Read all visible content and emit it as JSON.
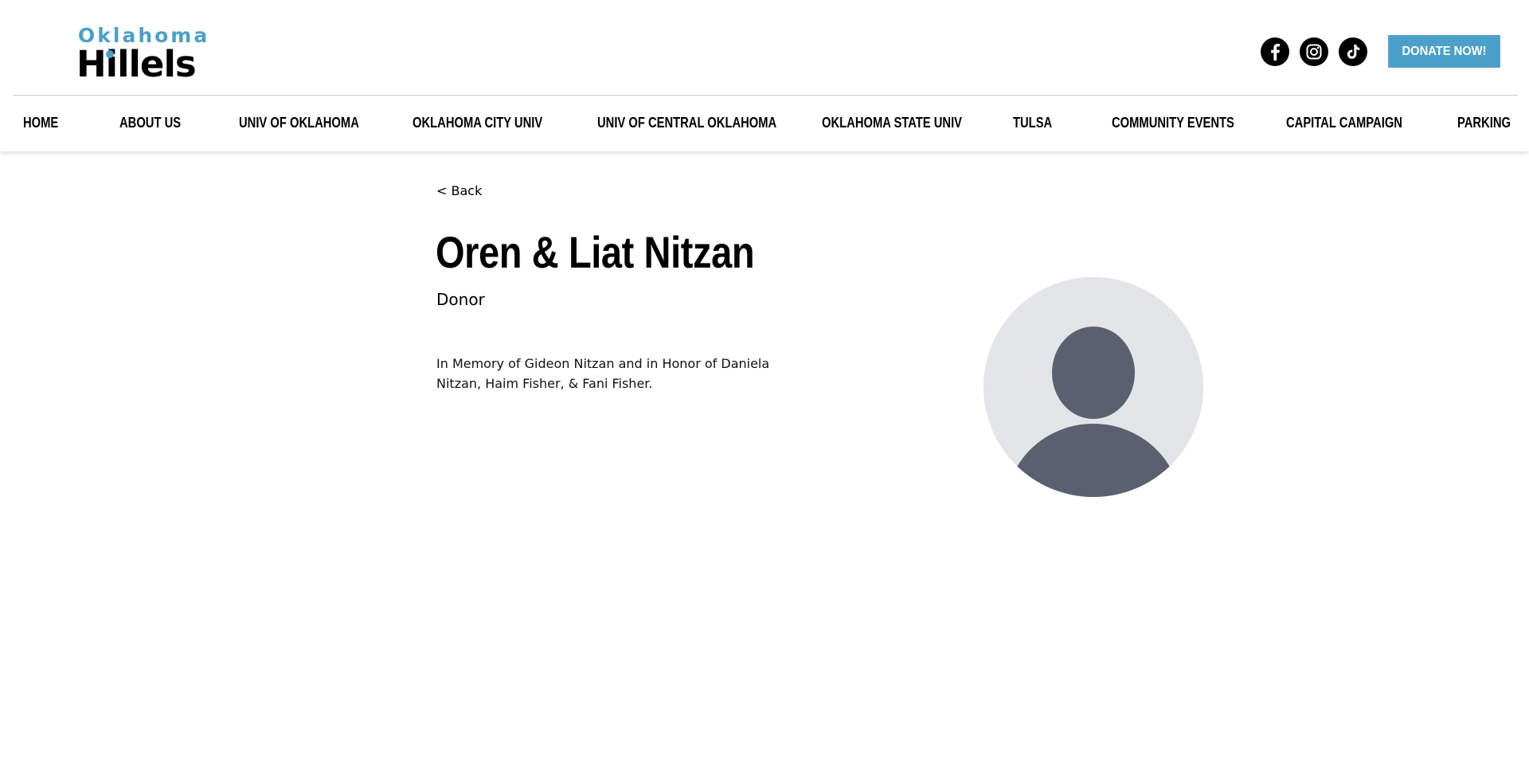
{
  "header": {
    "logo": {
      "line1": "Oklahoma",
      "line2": "Hillels"
    },
    "socials": [
      {
        "name": "facebook",
        "icon": "facebook-icon"
      },
      {
        "name": "instagram",
        "icon": "instagram-icon"
      },
      {
        "name": "tiktok",
        "icon": "tiktok-icon"
      }
    ],
    "donate_label": "DONATE NOW!"
  },
  "nav": {
    "items": [
      {
        "label": "HOME"
      },
      {
        "label": "ABOUT US"
      },
      {
        "label": "UNIV OF OKLAHOMA"
      },
      {
        "label": "OKLAHOMA CITY UNIV"
      },
      {
        "label": "UNIV OF CENTRAL OKLAHOMA"
      },
      {
        "label": "OKLAHOMA STATE UNIV"
      },
      {
        "label": "TULSA"
      },
      {
        "label": "COMMUNITY EVENTS"
      },
      {
        "label": "CAPITAL CAMPAIGN"
      },
      {
        "label": "PARKING"
      }
    ]
  },
  "profile": {
    "back_label": "< Back",
    "name": "Oren & Liat Nitzan",
    "role": "Donor",
    "bio": "In Memory of Gideon Nitzan and in Honor of Daniela Nitzan, Haim Fisher, & Fani Fisher.",
    "avatar_icon": "user-avatar-icon"
  },
  "colors": {
    "brand_blue": "#4ba0c9",
    "text": "#000000",
    "avatar_bg": "#e3e4e8",
    "avatar_fg": "#5a6070"
  }
}
